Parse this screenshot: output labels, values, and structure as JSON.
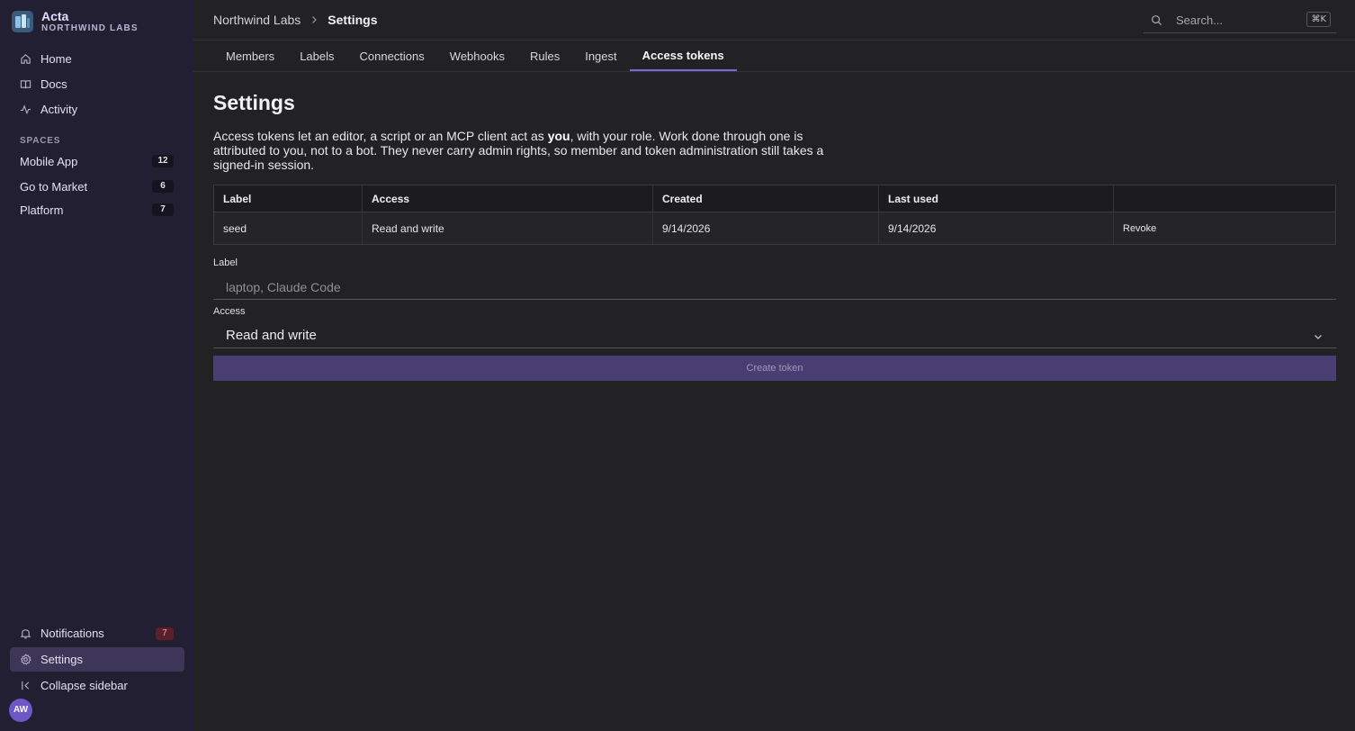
{
  "brand": {
    "name": "Acta",
    "org": "NORTHWIND LABS"
  },
  "sidebar": {
    "nav": [
      {
        "label": "Home",
        "icon": "home-icon"
      },
      {
        "label": "Docs",
        "icon": "book-icon"
      },
      {
        "label": "Activity",
        "icon": "activity-icon"
      }
    ],
    "spaces_label": "SPACES",
    "spaces": [
      {
        "label": "Mobile App",
        "count": "12"
      },
      {
        "label": "Go to Market",
        "count": "6"
      },
      {
        "label": "Platform",
        "count": "7"
      }
    ],
    "notifications": {
      "label": "Notifications",
      "count": "7"
    },
    "settings": {
      "label": "Settings"
    },
    "collapse": {
      "label": "Collapse sidebar"
    },
    "avatar_initials": "AW"
  },
  "header": {
    "breadcrumb_root": "Northwind Labs",
    "breadcrumb_current": "Settings",
    "search_placeholder": "Search...",
    "search_shortcut": "⌘K"
  },
  "tabs": [
    {
      "label": "Members",
      "active": false
    },
    {
      "label": "Labels",
      "active": false
    },
    {
      "label": "Connections",
      "active": false
    },
    {
      "label": "Webhooks",
      "active": false
    },
    {
      "label": "Rules",
      "active": false
    },
    {
      "label": "Ingest",
      "active": false
    },
    {
      "label": "Access tokens",
      "active": true
    }
  ],
  "main": {
    "title": "Settings",
    "intro_before": "Access tokens let an editor, a script or an MCP client act as ",
    "intro_bold": "you",
    "intro_after": ", with your role. Work done through one is attributed to you, not to a bot. They never carry admin rights, so member and token administration still takes a signed-in session.",
    "table": {
      "columns": [
        "Label",
        "Access",
        "Created",
        "Last used",
        ""
      ],
      "rows": [
        {
          "label": "seed",
          "access": "Read and write",
          "created": "9/14/2026",
          "last_used": "9/14/2026",
          "action": "Revoke"
        }
      ]
    },
    "form": {
      "label_field_label": "Label",
      "label_placeholder": "laptop, Claude Code",
      "access_field_label": "Access",
      "access_value": "Read and write",
      "submit_label": "Create token"
    }
  }
}
